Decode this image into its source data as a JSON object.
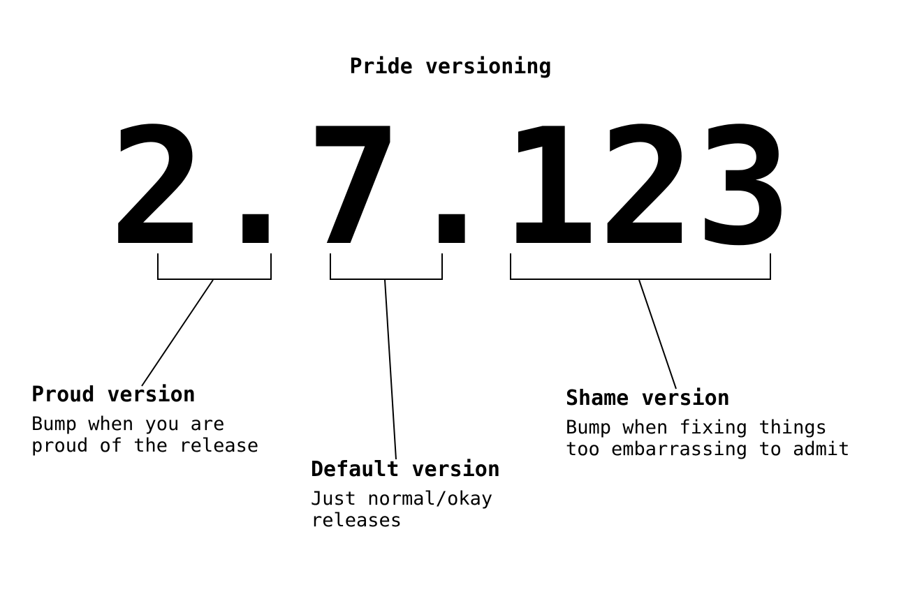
{
  "title": "Pride versioning",
  "version": {
    "proud": "2",
    "dot1": ".",
    "default": "7",
    "dot2": ".",
    "shame": "123"
  },
  "callouts": {
    "proud": {
      "heading": "Proud version",
      "desc": "Bump when you are\nproud of the release"
    },
    "default": {
      "heading": "Default version",
      "desc": "Just normal/okay\nreleases"
    },
    "shame": {
      "heading": "Shame version",
      "desc": "Bump when fixing things\ntoo embarrassing to admit"
    }
  }
}
